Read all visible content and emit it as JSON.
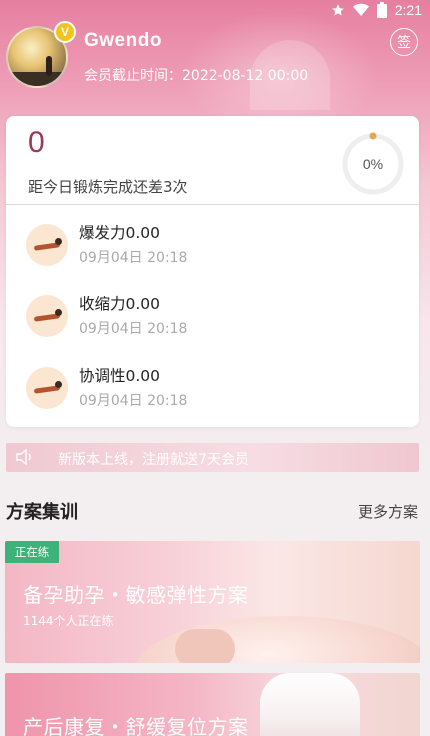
{
  "status_bar": {
    "time": "2:21"
  },
  "profile": {
    "username": "Gwendo",
    "vip_badge": "V",
    "member_expiry_label": "会员截止时间：2022-08-12 00:00",
    "checkin_label": "签"
  },
  "progress": {
    "count": "0",
    "description": "距今日锻炼完成还差3次",
    "percent_label": "0%",
    "percent_value": 0
  },
  "metrics": [
    {
      "name": "爆发力0.00",
      "date": "09月04日 20:18",
      "icon": "plank-exercise-icon"
    },
    {
      "name": "收缩力0.00",
      "date": "09月04日 20:18",
      "icon": "plank-exercise-icon"
    },
    {
      "name": "协调性0.00",
      "date": "09月04日 20:18",
      "icon": "plank-exercise-icon"
    }
  ],
  "notice": {
    "text": "新版本上线，注册就送7天会员",
    "icon": "speaker-icon"
  },
  "section": {
    "title": "方案集训",
    "more": "更多方案"
  },
  "plans": [
    {
      "tag": "正在练",
      "title": "备孕助孕・敏感弹性方案",
      "subtitle": "1144个人正在练"
    },
    {
      "title": "产后康复・舒缓复位方案"
    }
  ],
  "colors": {
    "accent": "#e67fa0",
    "count": "#9a3a55",
    "tag": "#3db37a",
    "ring_dot": "#e0a95a"
  }
}
